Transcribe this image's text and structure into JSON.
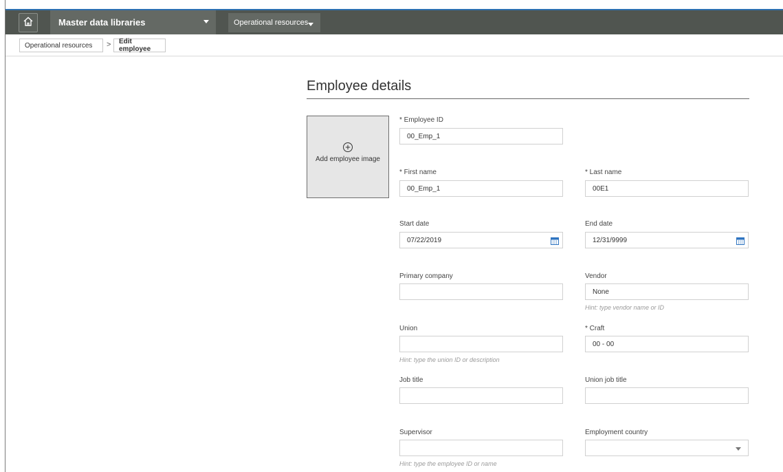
{
  "topbar": {
    "library_label": "Master data libraries",
    "module_label": "Operational resources"
  },
  "breadcrumb": {
    "items": [
      "Operational resources",
      "Edit employee"
    ],
    "separator": ">"
  },
  "page": {
    "title": "Employee details",
    "image_placeholder": "Add employee image"
  },
  "form": {
    "employee_id": {
      "label": "* Employee ID",
      "value": "00_Emp_1"
    },
    "first_name": {
      "label": "* First name",
      "value": "00_Emp_1"
    },
    "last_name": {
      "label": "* Last name",
      "value": "00E1"
    },
    "start_date": {
      "label": "Start date",
      "value": "07/22/2019"
    },
    "end_date": {
      "label": "End date",
      "value": "12/31/9999"
    },
    "primary_company": {
      "label": "Primary company",
      "value": ""
    },
    "vendor": {
      "label": "Vendor",
      "value": "None",
      "hint": "Hint: type vendor name or ID"
    },
    "union": {
      "label": "Union",
      "value": "",
      "hint": "Hint: type the union ID or description"
    },
    "craft": {
      "label": "* Craft",
      "value": "00 - 00"
    },
    "job_title": {
      "label": "Job title",
      "value": ""
    },
    "union_job_title": {
      "label": "Union job title",
      "value": ""
    },
    "supervisor": {
      "label": "Supervisor",
      "value": "",
      "hint": "Hint: type the employee ID or name"
    },
    "employment_country": {
      "label": "Employment country",
      "value": ""
    }
  },
  "colors": {
    "topbar_bg": "#505550",
    "accent": "#2c6fb1",
    "calendar_icon": "#2f74c0"
  }
}
